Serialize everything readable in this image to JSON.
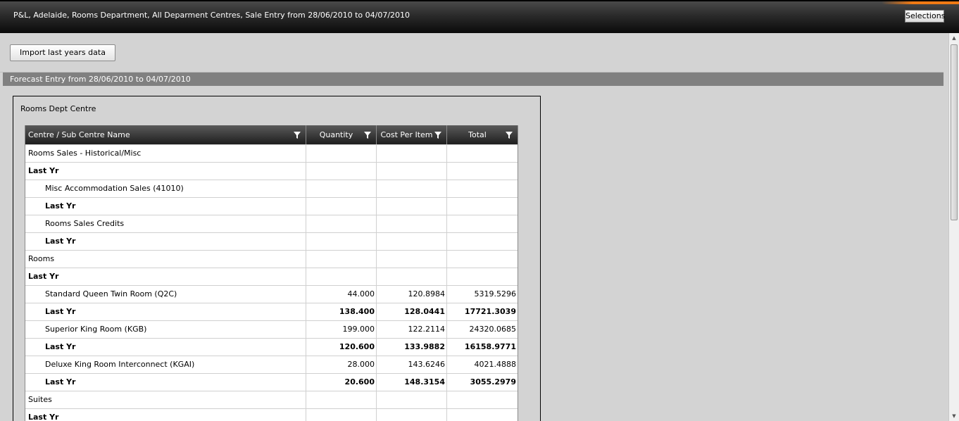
{
  "header": {
    "title": "P&L, Adelaide, Rooms Department, All Deparment Centres, Sale Entry from 28/06/2010 to 04/07/2010",
    "selections_label": "Selections",
    "accent_color": "#f07a14"
  },
  "toolbar": {
    "import_label": "Import last years data"
  },
  "forecast": {
    "title": "Forecast Entry from 28/06/2010 to 04/07/2010"
  },
  "panel": {
    "title": "Rooms Dept Centre"
  },
  "grid": {
    "columns": [
      {
        "label": "Centre / Sub Centre Name",
        "icon": "filter-icon"
      },
      {
        "label": "Quantity",
        "icon": "filter-icon"
      },
      {
        "label": "Cost Per Item",
        "icon": "filter-icon"
      },
      {
        "label": "Total",
        "icon": "filter-icon"
      }
    ],
    "rows": [
      {
        "name": "Rooms Sales - Historical/Misc",
        "qty": "",
        "cost": "",
        "total": "",
        "indent": false,
        "bold": false
      },
      {
        "name": "Last Yr",
        "qty": "",
        "cost": "",
        "total": "",
        "indent": false,
        "bold": true
      },
      {
        "name": "Misc Accommodation Sales (41010)",
        "qty": "",
        "cost": "",
        "total": "",
        "indent": true,
        "bold": false
      },
      {
        "name": "Last Yr",
        "qty": "",
        "cost": "",
        "total": "",
        "indent": true,
        "bold": true
      },
      {
        "name": "Rooms Sales Credits",
        "qty": "",
        "cost": "",
        "total": "",
        "indent": true,
        "bold": false
      },
      {
        "name": "Last Yr",
        "qty": "",
        "cost": "",
        "total": "",
        "indent": true,
        "bold": true
      },
      {
        "name": "Rooms",
        "qty": "",
        "cost": "",
        "total": "",
        "indent": false,
        "bold": false
      },
      {
        "name": "Last Yr",
        "qty": "",
        "cost": "",
        "total": "",
        "indent": false,
        "bold": true
      },
      {
        "name": "Standard Queen Twin Room (Q2C)",
        "qty": "44.000",
        "cost": "120.8984",
        "total": "5319.5296",
        "indent": true,
        "bold": false
      },
      {
        "name": "Last Yr",
        "qty": "138.400",
        "cost": "128.0441",
        "total": "17721.3039",
        "indent": true,
        "bold": true
      },
      {
        "name": "Superior King Room (KGB)",
        "qty": "199.000",
        "cost": "122.2114",
        "total": "24320.0685",
        "indent": true,
        "bold": false
      },
      {
        "name": "Last Yr",
        "qty": "120.600",
        "cost": "133.9882",
        "total": "16158.9771",
        "indent": true,
        "bold": true
      },
      {
        "name": "Deluxe King Room Interconnect (KGAI)",
        "qty": "28.000",
        "cost": "143.6246",
        "total": "4021.4888",
        "indent": true,
        "bold": false
      },
      {
        "name": "Last Yr",
        "qty": "20.600",
        "cost": "148.3154",
        "total": "3055.2979",
        "indent": true,
        "bold": true
      },
      {
        "name": "Suites",
        "qty": "",
        "cost": "",
        "total": "",
        "indent": false,
        "bold": false
      },
      {
        "name": "Last Yr",
        "qty": "",
        "cost": "",
        "total": "",
        "indent": false,
        "bold": true
      }
    ]
  }
}
